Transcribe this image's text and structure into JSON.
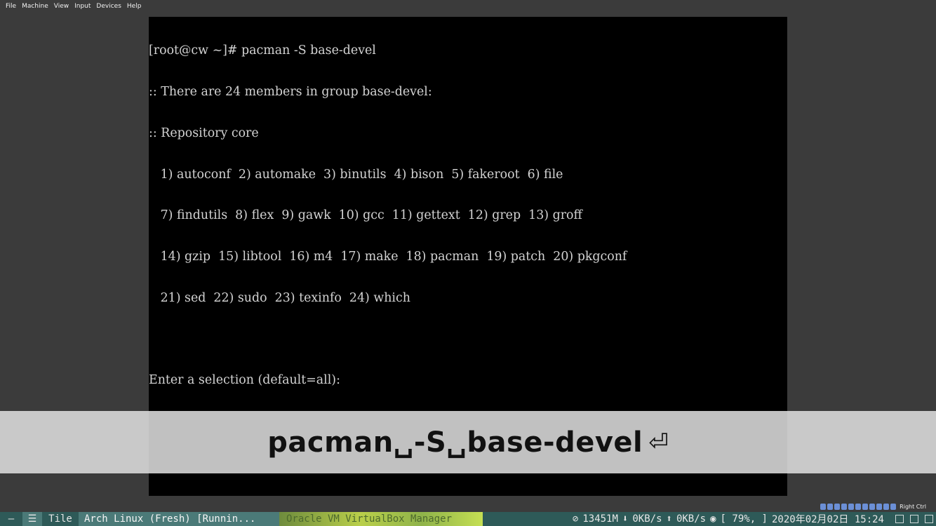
{
  "menubar": {
    "items": [
      "File",
      "Machine",
      "View",
      "Input",
      "Devices",
      "Help"
    ]
  },
  "terminal": {
    "lines": [
      "[root@cw ~]# pacman -S base-devel",
      ":: There are 24 members in group base-devel:",
      ":: Repository core",
      "   1) autoconf  2) automake  3) binutils  4) bison  5) fakeroot  6) file",
      "   7) findutils  8) flex  9) gawk  10) gcc  11) gettext  12) grep  13) groff",
      "   14) gzip  15) libtool  16) m4  17) make  18) pacman  19) patch  20) pkgconf",
      "   21) sed  22) sudo  23) texinfo  24) which",
      "",
      "Enter a selection (default=all):"
    ]
  },
  "key_overlay": {
    "text": "pacman␣-S␣base-devel",
    "return_symbol": "⏎"
  },
  "tray": {
    "host_key": "Right Ctrl"
  },
  "taskbar": {
    "dash": "—",
    "menu": "☰",
    "layout": "Tile",
    "active_window": "Arch Linux (Fresh) [Runnin...",
    "inactive_window": "Oracle VM VirtualBox Manager",
    "memory": "13451M",
    "down": "0KB/s",
    "up": "0KB/s",
    "volume": "[   79%,   ]",
    "datetime": "2020年02月02日 15:24"
  }
}
